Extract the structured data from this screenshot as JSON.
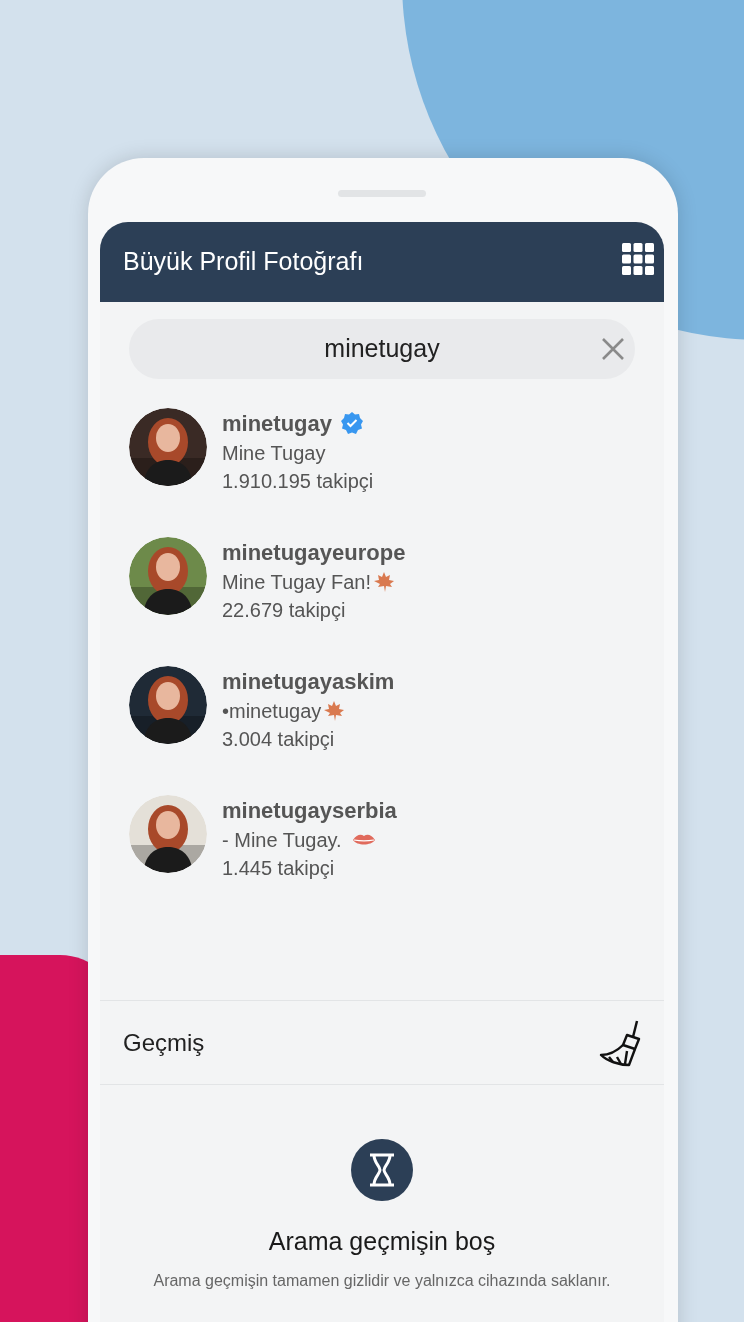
{
  "app_bar": {
    "title": "Büyük Profil Fotoğrafı"
  },
  "search": {
    "value": "minetugay"
  },
  "results": [
    {
      "kind": "plain",
      "username": "minetugay",
      "verified": true,
      "bio": "Mine Tugay",
      "followers": "1.910.195 takipçi"
    },
    {
      "kind": "leaf",
      "username": "minetugayeurope",
      "verified": false,
      "bio": "Mine Tugay Fan!",
      "followers": "22.679 takipçi"
    },
    {
      "kind": "leaf",
      "username": "minetugayaskim",
      "verified": false,
      "bio": "•minetugay",
      "followers": "3.004 takipçi"
    },
    {
      "kind": "lips",
      "username": "minetugayserbia",
      "verified": false,
      "bio": "- Mine Tugay.",
      "followers": "1.445 takipçi"
    }
  ],
  "history": {
    "title": "Geçmiş",
    "empty_title": "Arama geçmişin boş",
    "empty_text": "Arama geçmişin tamamen gizlidir ve yalnızca cihazında saklanır."
  }
}
